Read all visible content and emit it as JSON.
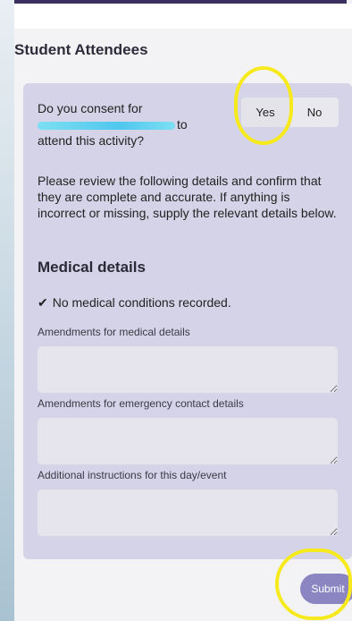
{
  "section": {
    "title": "Student Attendees"
  },
  "consent": {
    "question_prefix": "Do you consent for",
    "question_mid": "to",
    "question_suffix": "attend this activity?",
    "yes_label": "Yes",
    "no_label": "No"
  },
  "review_text": "Please review the following details and confirm that they are complete and accurate. If anything is incorrect or missing, supply the relevant details below.",
  "medical": {
    "title": "Medical details",
    "status_text": "No medical conditions recorded.",
    "status_icon": "check-icon"
  },
  "fields": [
    {
      "label": "Amendments for medical details",
      "value": ""
    },
    {
      "label": "Amendments for emergency contact details",
      "value": ""
    },
    {
      "label": "Additional instructions for this day/event",
      "value": ""
    }
  ],
  "actions": {
    "submit_label": "Submit"
  },
  "colors": {
    "card": "#d4d3e8",
    "submit": "#8b86c2",
    "highlight": "#f6ea1c"
  }
}
